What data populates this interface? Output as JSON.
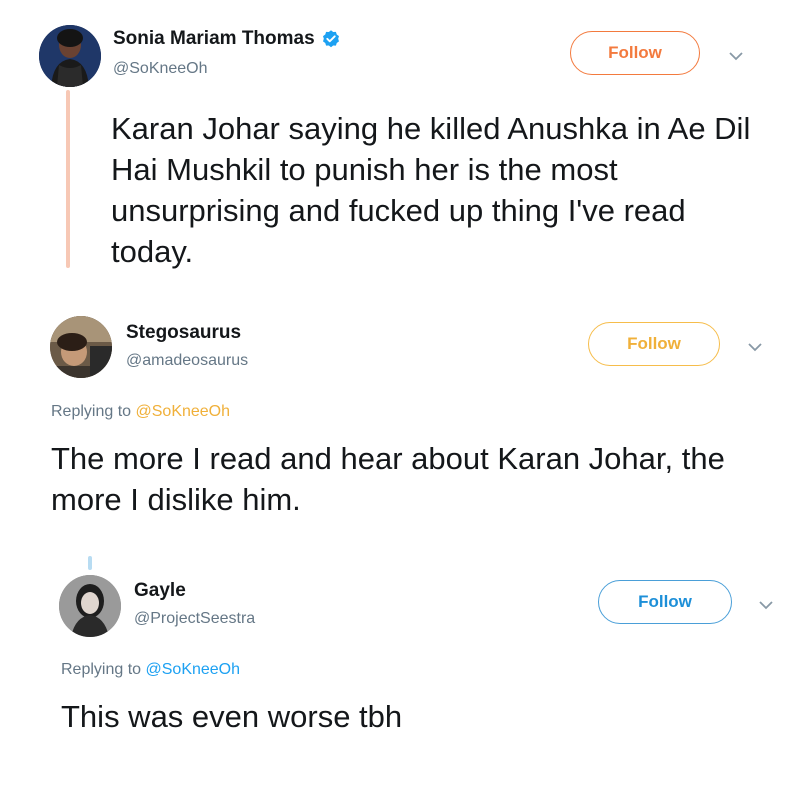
{
  "colors": {
    "thread_line_1": "#f7c8b5",
    "thread_line_2": "#b8dcf2",
    "follow_1": "#f37a3e",
    "follow_2": "#f6bd4b",
    "follow_3": "#4a9fd8",
    "mention_2": "#f0b03a",
    "mention_3": "#1da1f2",
    "verified": "#1da1f2",
    "muted": "#657786"
  },
  "tweets": [
    {
      "name": "Sonia Mariam Thomas",
      "handle": "@SoKneeOh",
      "verified": true,
      "follow_label": "Follow",
      "text": "Karan Johar saying he killed Anushka in Ae Dil Hai Mushkil to punish her is the most unsurprising and fucked up thing I've read today."
    },
    {
      "name": "Stegosaurus",
      "handle": "@amadeosaurus",
      "follow_label": "Follow",
      "replying_prefix": "Replying to ",
      "replying_to": "@SoKneeOh",
      "text": "The more I read and hear about Karan Johar, the more I dislike him."
    },
    {
      "name": "Gayle",
      "handle": "@ProjectSeestra",
      "follow_label": "Follow",
      "replying_prefix": "Replying to ",
      "replying_to": "@SoKneeOh",
      "text": "This was even worse tbh"
    }
  ],
  "icons": {
    "verified": "verified-badge-icon",
    "chevron": "chevron-down-icon"
  }
}
